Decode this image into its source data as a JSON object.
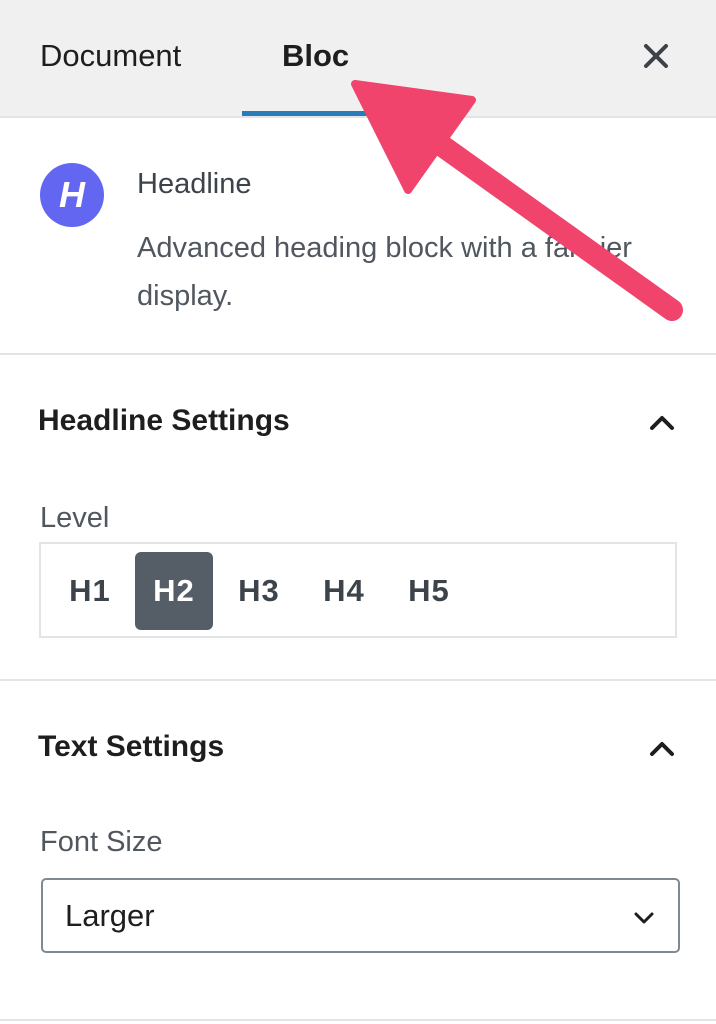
{
  "tabs": {
    "document_label": "Document",
    "block_label": "Bloc",
    "close_icon": "close-icon"
  },
  "block_card": {
    "icon_letter": "H",
    "icon_color": "#6366f1",
    "title": "Headline",
    "description": "Advanced heading block with a fancier display."
  },
  "headline_settings": {
    "title": "Headline Settings",
    "toggle_icon": "chevron-up-icon",
    "level_label": "Level",
    "levels": [
      "H1",
      "H2",
      "H3",
      "H4",
      "H5"
    ],
    "selected_level": "H2"
  },
  "text_settings": {
    "title": "Text Settings",
    "toggle_icon": "chevron-up-icon",
    "font_size_label": "Font Size",
    "font_size_value": "Larger",
    "select_icon": "chevron-down-icon"
  },
  "colors": {
    "tab_underline": "#2b7bb9",
    "active_level_bg": "#555d66",
    "annotation_arrow": "#f0446c"
  }
}
